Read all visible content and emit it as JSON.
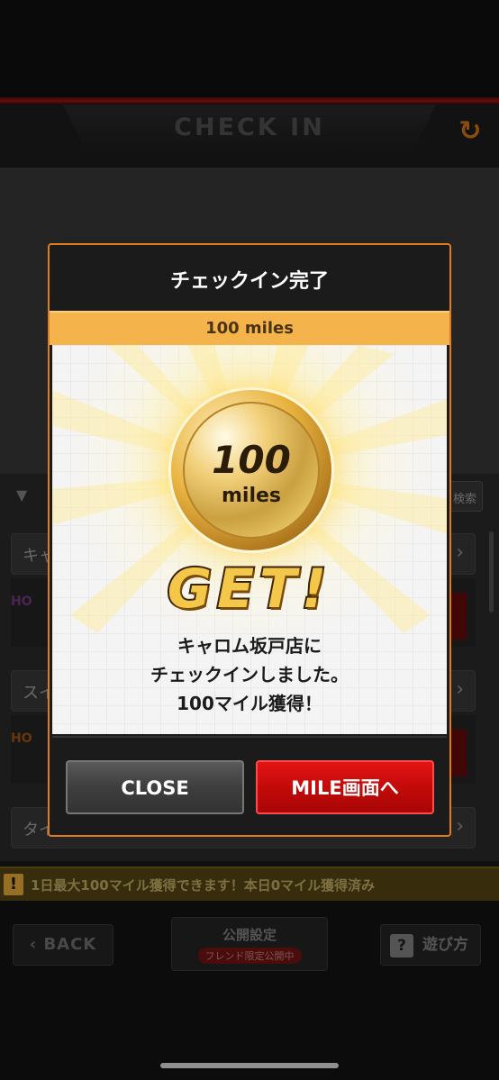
{
  "header": {
    "title": "CHECK IN",
    "refresh_icon": "refresh-icon",
    "accent_color": "#e07a14"
  },
  "background": {
    "search_label": "検索",
    "card_1_label": "キャ",
    "card_2_label": "スイ",
    "card_3_label": "タイ",
    "logo_text": "HO"
  },
  "info_bar": {
    "icon": "!",
    "text": "1日最大100マイル獲得できます！本日0マイル獲得済み"
  },
  "footer": {
    "back_label": "BACK",
    "public_setting_label": "公開設定",
    "public_setting_badge": "フレンド限定公開中",
    "help_label": "遊び方",
    "help_icon": "?"
  },
  "modal": {
    "title": "チェックイン完了",
    "miles_banner": "100 miles",
    "coin_value": "100",
    "coin_unit": "miles",
    "get_text": "GET!",
    "message_lines": [
      "キャロム坂戸店に",
      "チェックインしました。",
      "100マイル獲得！"
    ],
    "close_label": "CLOSE",
    "mile_label": "MILE画面へ",
    "border_color": "#e07b1e",
    "mile_button_color": "#d10e0e"
  }
}
